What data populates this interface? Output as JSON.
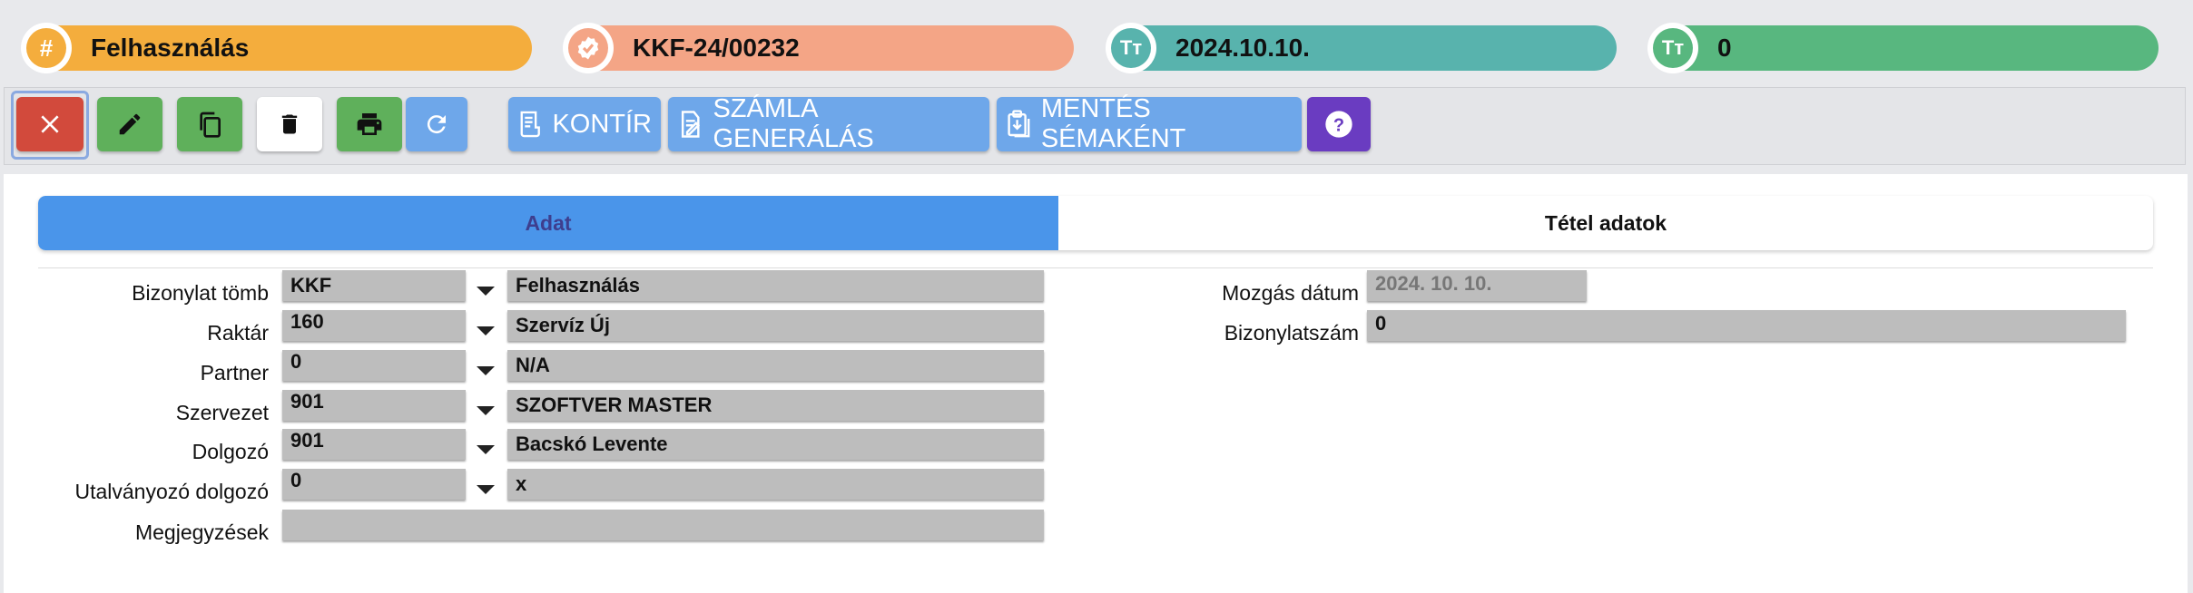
{
  "status": {
    "type": {
      "value": "Felhasználás",
      "icon": "hash-icon",
      "color": "#f4ad3d"
    },
    "number": {
      "value": "KKF-24/00232",
      "icon": "check-badge-icon",
      "color": "#f4a586"
    },
    "date": {
      "value": "2024.10.10.",
      "icon": "text-type-icon",
      "color": "#58b3ad"
    },
    "count": {
      "value": "0",
      "icon": "text-type-icon",
      "color": "#58b77f"
    }
  },
  "toolbar": {
    "close": {
      "icon": "close-icon",
      "color": "#d24a3c"
    },
    "edit": {
      "icon": "pencil-icon",
      "color": "#5fb05b"
    },
    "copy": {
      "icon": "copy-icon",
      "color": "#5fb05b"
    },
    "delete": {
      "icon": "trash-icon",
      "color": "#ffffff"
    },
    "print": {
      "icon": "printer-icon",
      "color": "#5fb05b"
    },
    "refresh": {
      "icon": "refresh-icon",
      "color": "#6ea7ea"
    },
    "kontir_label": "KONTÍR",
    "szamla_label": "SZÁMLA GENERÁLÁS",
    "mentes_label": "MENTÉS SÉMAKÉNT",
    "help": {
      "icon": "help-icon",
      "color": "#6a3cc1"
    }
  },
  "tabs": [
    {
      "label": "Adat",
      "active": true
    },
    {
      "label": "Tétel adatok",
      "active": false
    }
  ],
  "form": {
    "left": [
      {
        "label": "Bizonylat tömb",
        "code": "KKF",
        "name": "Felhasználás"
      },
      {
        "label": "Raktár",
        "code": "160",
        "name": "Szervíz Új"
      },
      {
        "label": "Partner",
        "code": "0",
        "name": "N/A"
      },
      {
        "label": "Szervezet",
        "code": "901",
        "name": "SZOFTVER MASTER"
      },
      {
        "label": "Dolgozó",
        "code": "901",
        "name": "Bacskó Levente"
      },
      {
        "label": "Utalványozó dolgozó",
        "code": "0",
        "name": "x"
      }
    ],
    "notes": {
      "label": "Megjegyzések",
      "value": ""
    },
    "right": {
      "date_label": "Mozgás dátum",
      "date_value": "2024. 10. 10.",
      "doc_label": "Bizonylatszám",
      "doc_value": "0"
    }
  }
}
